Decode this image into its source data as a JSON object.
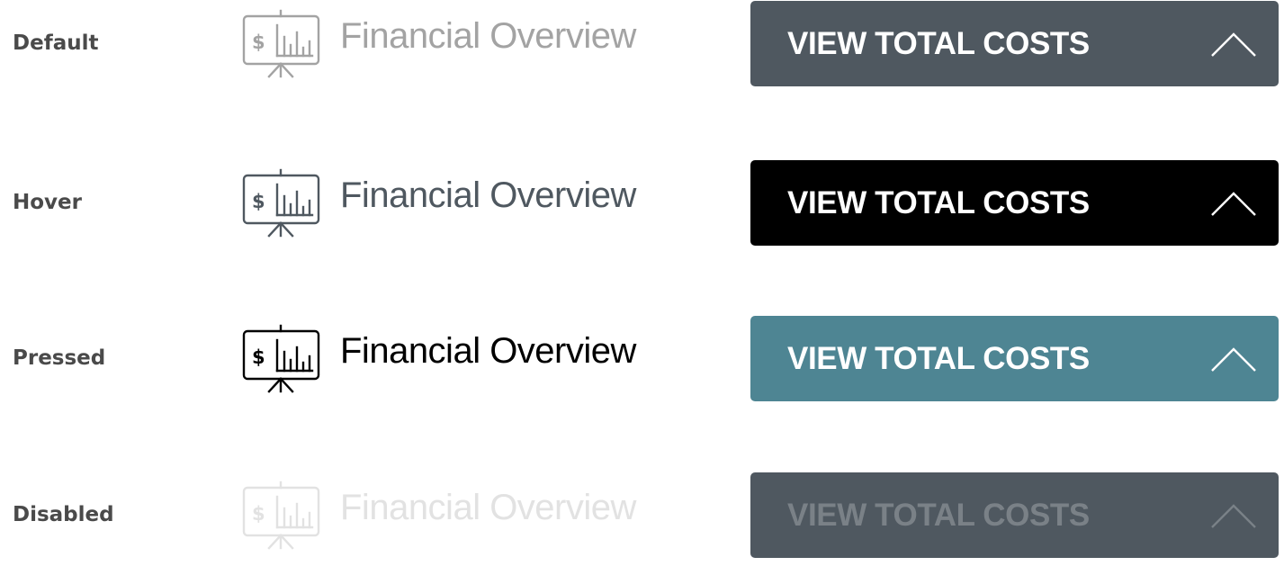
{
  "states": [
    {
      "state": "Default",
      "link_text": "Financial Overview",
      "button_label": "VIEW TOTAL COSTS",
      "colors": {
        "label": "#4a4a4a",
        "link": "#a3a3a3",
        "icon": "#a3a3a3",
        "button_bg": "#4f5860",
        "button_text": "#ffffff",
        "chevron": "#ffffff"
      }
    },
    {
      "state": "Hover",
      "link_text": "Financial Overview",
      "button_label": "VIEW TOTAL COSTS",
      "colors": {
        "label": "#4a4a4a",
        "link": "#4f5860",
        "icon": "#4f5860",
        "button_bg": "#000000",
        "button_text": "#ffffff",
        "chevron": "#ffffff"
      }
    },
    {
      "state": "Pressed",
      "link_text": "Financial Overview",
      "button_label": "VIEW TOTAL COSTS",
      "colors": {
        "label": "#4a4a4a",
        "link": "#000000",
        "icon": "#000000",
        "button_bg": "#4e8593",
        "button_text": "#ffffff",
        "chevron": "#ffffff"
      }
    },
    {
      "state": "Disabled",
      "link_text": "Financial Overview",
      "button_label": "VIEW TOTAL COSTS",
      "colors": {
        "label": "#4a4a4a",
        "link": "#e2e2e2",
        "icon": "#e2e2e2",
        "button_bg": "#4f5860",
        "button_text": "#7a8187",
        "chevron": "#7a8187"
      }
    }
  ],
  "icons": {
    "link_icon": "financial-presentation-icon",
    "button_icon": "chevron-up-icon"
  }
}
